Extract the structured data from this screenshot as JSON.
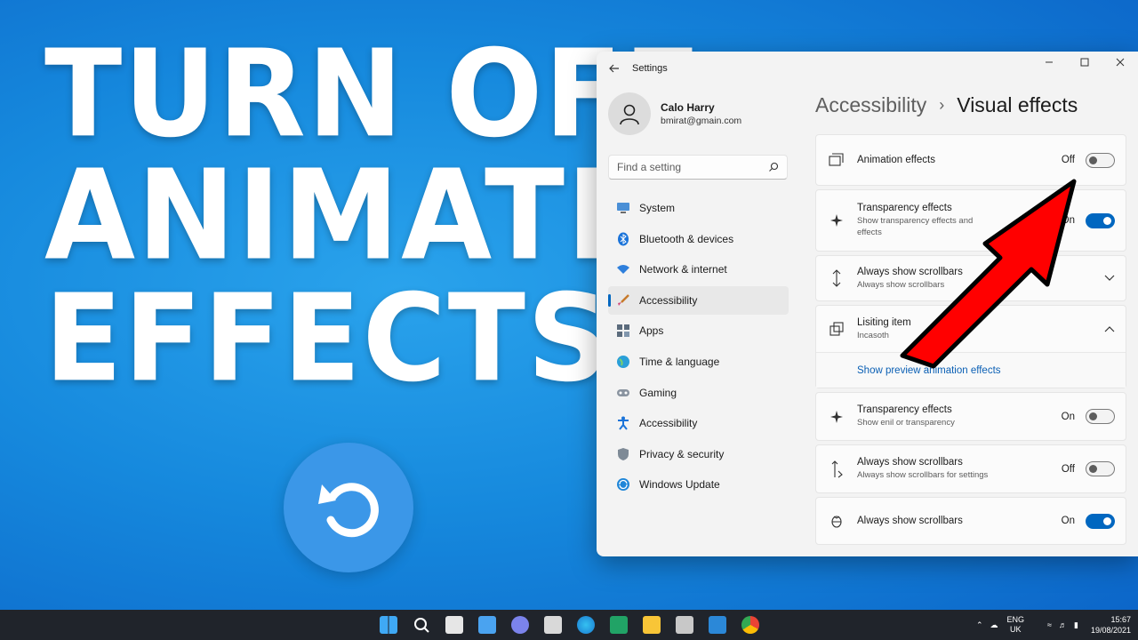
{
  "headline": {
    "line1": "Turn off",
    "line2": "Animation",
    "line3": "Effects"
  },
  "window": {
    "title": "Settings",
    "profile": {
      "name": "Calo Harry",
      "email": "bmirat@gmain.com"
    },
    "search_placeholder": "Find a setting",
    "nav": [
      {
        "label": "System",
        "icon": "monitor-icon"
      },
      {
        "label": "Bluetooth & devices",
        "icon": "bluetooth-icon"
      },
      {
        "label": "Network & internet",
        "icon": "wifi-icon"
      },
      {
        "label": "Accessibility",
        "icon": "brush-icon",
        "active": true
      },
      {
        "label": "Apps",
        "icon": "apps-icon"
      },
      {
        "label": "Time & language",
        "icon": "globe-icon"
      },
      {
        "label": "Gaming",
        "icon": "gamepad-icon"
      },
      {
        "label": "Accessibility",
        "icon": "accessibility-icon"
      },
      {
        "label": "Privacy & security",
        "icon": "shield-icon"
      },
      {
        "label": "Windows Update",
        "icon": "update-icon"
      }
    ],
    "breadcrumb": {
      "parent": "Accessibility",
      "separator": "›",
      "current": "Visual effects"
    },
    "cards": [
      {
        "title": "Animation effects",
        "state": "Off",
        "toggle": "off"
      },
      {
        "title": "Transparency effects",
        "sub1": "Show transparency effects and",
        "sub2": "effects",
        "state": "On",
        "toggle": "on"
      },
      {
        "title": "Always show scrollbars",
        "sub1": "Always show scrollbars"
      },
      {
        "title": "Lisiting item",
        "sub1": "Incasoth",
        "link": "Show preview animation effects"
      },
      {
        "title": "Transparency effects",
        "sub1": "Show enil or transparency",
        "state": "On",
        "toggle": "off"
      },
      {
        "title": "Always show scrollbars",
        "sub1": "Always show scrollbars for settings",
        "state": "Off",
        "toggle": "off"
      },
      {
        "title": "Always show scrollbars",
        "state": "On",
        "toggle": "on"
      }
    ]
  },
  "taskbar": {
    "language": "ENG",
    "region": "UK",
    "time": "15:67",
    "date": "19/08/2021"
  },
  "colors": {
    "accent": "#0067c0",
    "arrow": "#ff0000",
    "background": "#1689dd"
  }
}
